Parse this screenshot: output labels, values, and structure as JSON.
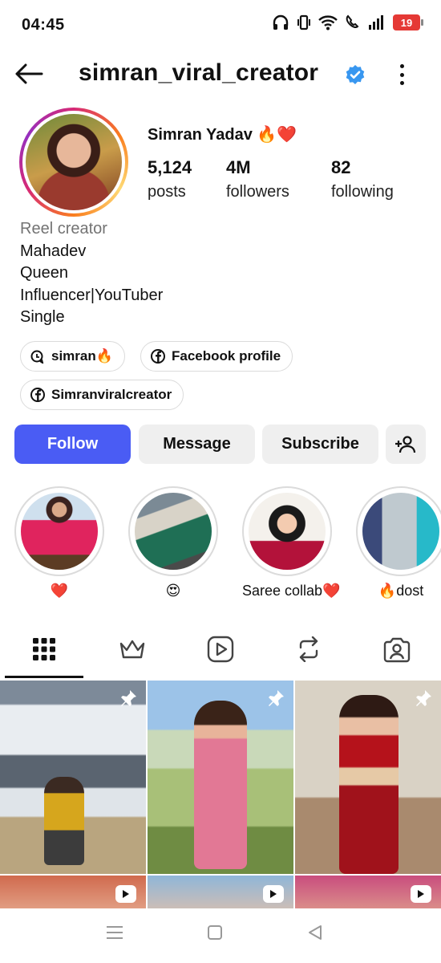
{
  "status_bar": {
    "time": "04:45",
    "battery": "19"
  },
  "header": {
    "username": "simran_viral_creator"
  },
  "profile": {
    "display_name": "Simran Yadav 🔥❤️",
    "stats": [
      {
        "value": "5,124",
        "label": "posts"
      },
      {
        "value": "4M",
        "label": "followers"
      },
      {
        "value": "82",
        "label": "following"
      }
    ],
    "category": "Reel creator",
    "bio_lines": [
      "Mahadev",
      "Queen",
      "Influencer|YouTuber",
      "Single"
    ]
  },
  "chips": [
    {
      "label": "simran🔥",
      "icon": "threads-icon"
    },
    {
      "label": "Facebook profile",
      "icon": "facebook-icon"
    },
    {
      "label": "Simranviralcreator",
      "icon": "facebook-icon"
    }
  ],
  "actions": {
    "follow": "Follow",
    "message": "Message",
    "subscribe": "Subscribe"
  },
  "highlights": [
    {
      "label": "❤️"
    },
    {
      "label": "😍"
    },
    {
      "label": "Saree collab❤️"
    },
    {
      "label": "🔥dost"
    }
  ],
  "tabs": [
    {
      "icon": "grid-icon",
      "active": true
    },
    {
      "icon": "crown-icon",
      "active": false
    },
    {
      "icon": "reels-icon",
      "active": false
    },
    {
      "icon": "repost-icon",
      "active": false
    },
    {
      "icon": "tagged-icon",
      "active": false
    }
  ],
  "colors": {
    "primary_button": "#4a5cf4",
    "verified": "#3897f0"
  }
}
